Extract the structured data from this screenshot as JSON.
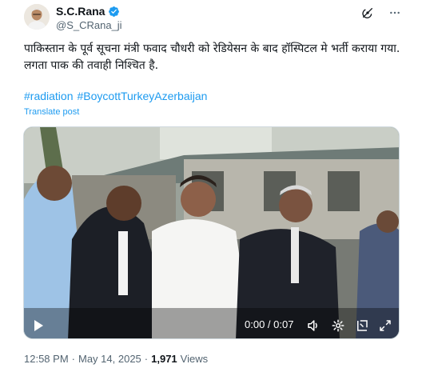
{
  "author": {
    "display_name": "S.C.Rana",
    "handle": "@S_CRana_ji",
    "verified": true,
    "verified_color": "#1d9bf0"
  },
  "header_icons": [
    "grok-icon",
    "more-icon"
  ],
  "tweet": {
    "text": "पाकिस्तान के पूर्व सूचना मंत्री फवाद चौधरी को रेडियेसन के बाद हॉस्पिटल मे भर्ती कराया गया. लगता पाक की तवाही निश्चित है.",
    "hashtags": [
      "#radiation",
      "#BoycottTurkeyAzerbaijan"
    ],
    "translate_label": "Translate post"
  },
  "video": {
    "time_display": "0:00 / 0:07",
    "controls": [
      "play-icon",
      "volume-icon",
      "settings-icon",
      "gif-icon",
      "fullscreen-icon"
    ]
  },
  "meta": {
    "time": "12:58 PM",
    "separator": "·",
    "date": "May 14, 2025",
    "views_count": "1,971",
    "views_label": "Views"
  },
  "colors": {
    "link": "#1d9bf0",
    "secondary_text": "#536471",
    "primary_text": "#0f1419"
  }
}
